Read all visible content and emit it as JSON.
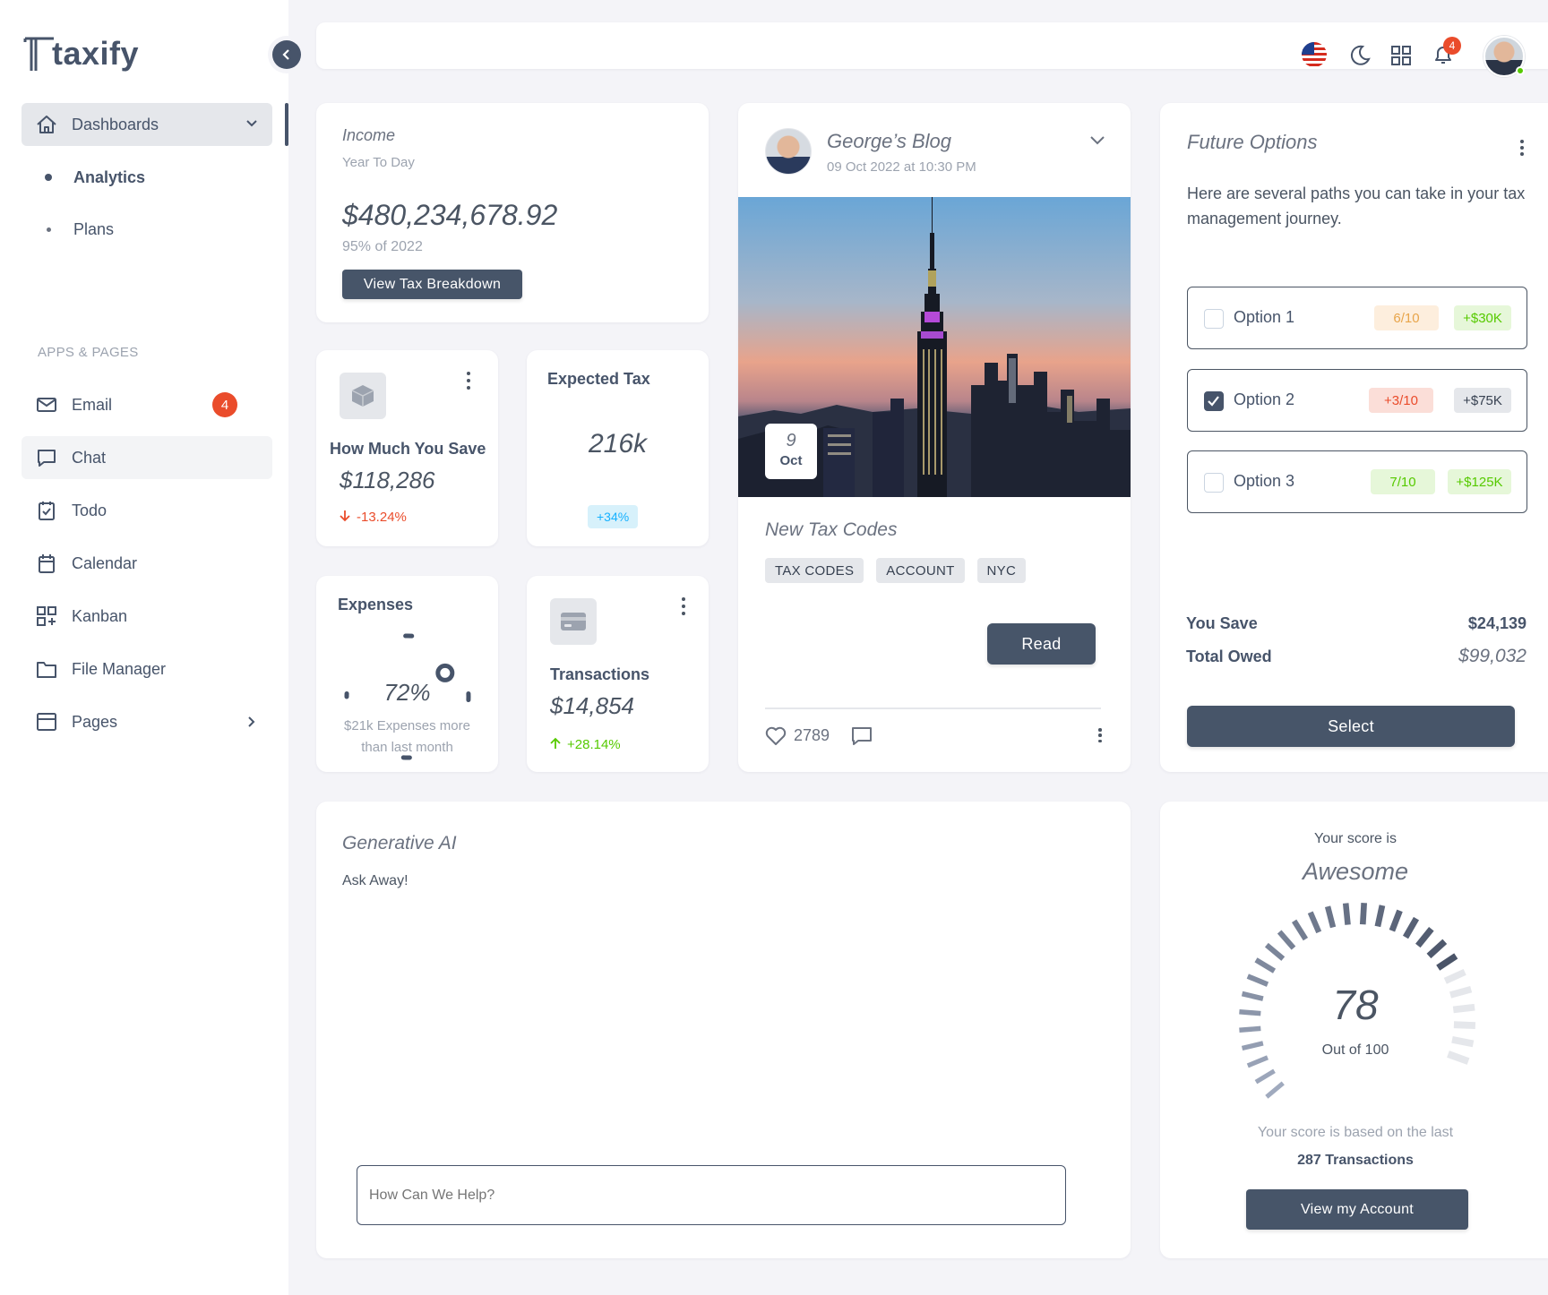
{
  "brand": {
    "name": "taxify"
  },
  "sidebar": {
    "dashboards_label": "Dashboards",
    "sub_items": [
      {
        "label": "Analytics"
      },
      {
        "label": "Plans"
      }
    ],
    "section_title": "APPS & PAGES",
    "items": [
      {
        "label": "Email",
        "badge": "4"
      },
      {
        "label": "Chat"
      },
      {
        "label": "Todo"
      },
      {
        "label": "Calendar"
      },
      {
        "label": "Kanban"
      },
      {
        "label": "File Manager"
      },
      {
        "label": "Pages"
      }
    ]
  },
  "header": {
    "notification_count": "4"
  },
  "income": {
    "title": "Income",
    "subtitle": "Year To Day",
    "amount": "$480,234,678.92",
    "note": "95% of 2022",
    "button": "View Tax Breakdown"
  },
  "save_card": {
    "title": "How Much You Save",
    "amount": "$118,286",
    "change": "-13.24%"
  },
  "expected_tax": {
    "title": "Expected Tax",
    "value": "216k",
    "change": "+34%"
  },
  "expenses": {
    "title": "Expenses",
    "percent": "72%",
    "percent_value": 72,
    "note_line1": "$21k Expenses more",
    "note_line2": "than last month"
  },
  "transactions": {
    "title": "Transactions",
    "amount": "$14,854",
    "change": "+28.14%"
  },
  "blog": {
    "author_title": "George’s Blog",
    "date": "09 Oct 2022 at 10:30 PM",
    "day": "9",
    "month": "Oct",
    "post_title": "New Tax Codes",
    "tags": [
      "TAX CODES",
      "ACCOUNT",
      "NYC"
    ],
    "read_button": "Read",
    "likes": "2789"
  },
  "future_options": {
    "title": "Future Options",
    "description": "Here are several paths you can take in your tax management journey.",
    "options": [
      {
        "label": "Option 1",
        "checked": false,
        "score": "6/10",
        "amount": "+$30K"
      },
      {
        "label": "Option 2",
        "checked": true,
        "score": "+3/10",
        "amount": "+$75K"
      },
      {
        "label": "Option 3",
        "checked": false,
        "score": "7/10",
        "amount": "+$125K"
      }
    ],
    "you_save_label": "You Save",
    "you_save_value": "$24,139",
    "total_owed_label": "Total Owed",
    "total_owed_value": "$99,032",
    "select_button": "Select"
  },
  "generative_ai": {
    "title": "Generative AI",
    "subtitle": "Ask Away!",
    "input_placeholder": "How Can We Help?"
  },
  "score": {
    "heading": "Your score is",
    "rating": "Awesome",
    "value": "78",
    "value_num": 78,
    "out_of": "Out of 100",
    "basis": "Your score is based on the last",
    "transactions": "287 Transactions",
    "button": "View my Account"
  },
  "colors": {
    "accent": "#475569",
    "danger": "#ea4c2b",
    "success": "#56ca00",
    "info": "#16b1ff"
  }
}
